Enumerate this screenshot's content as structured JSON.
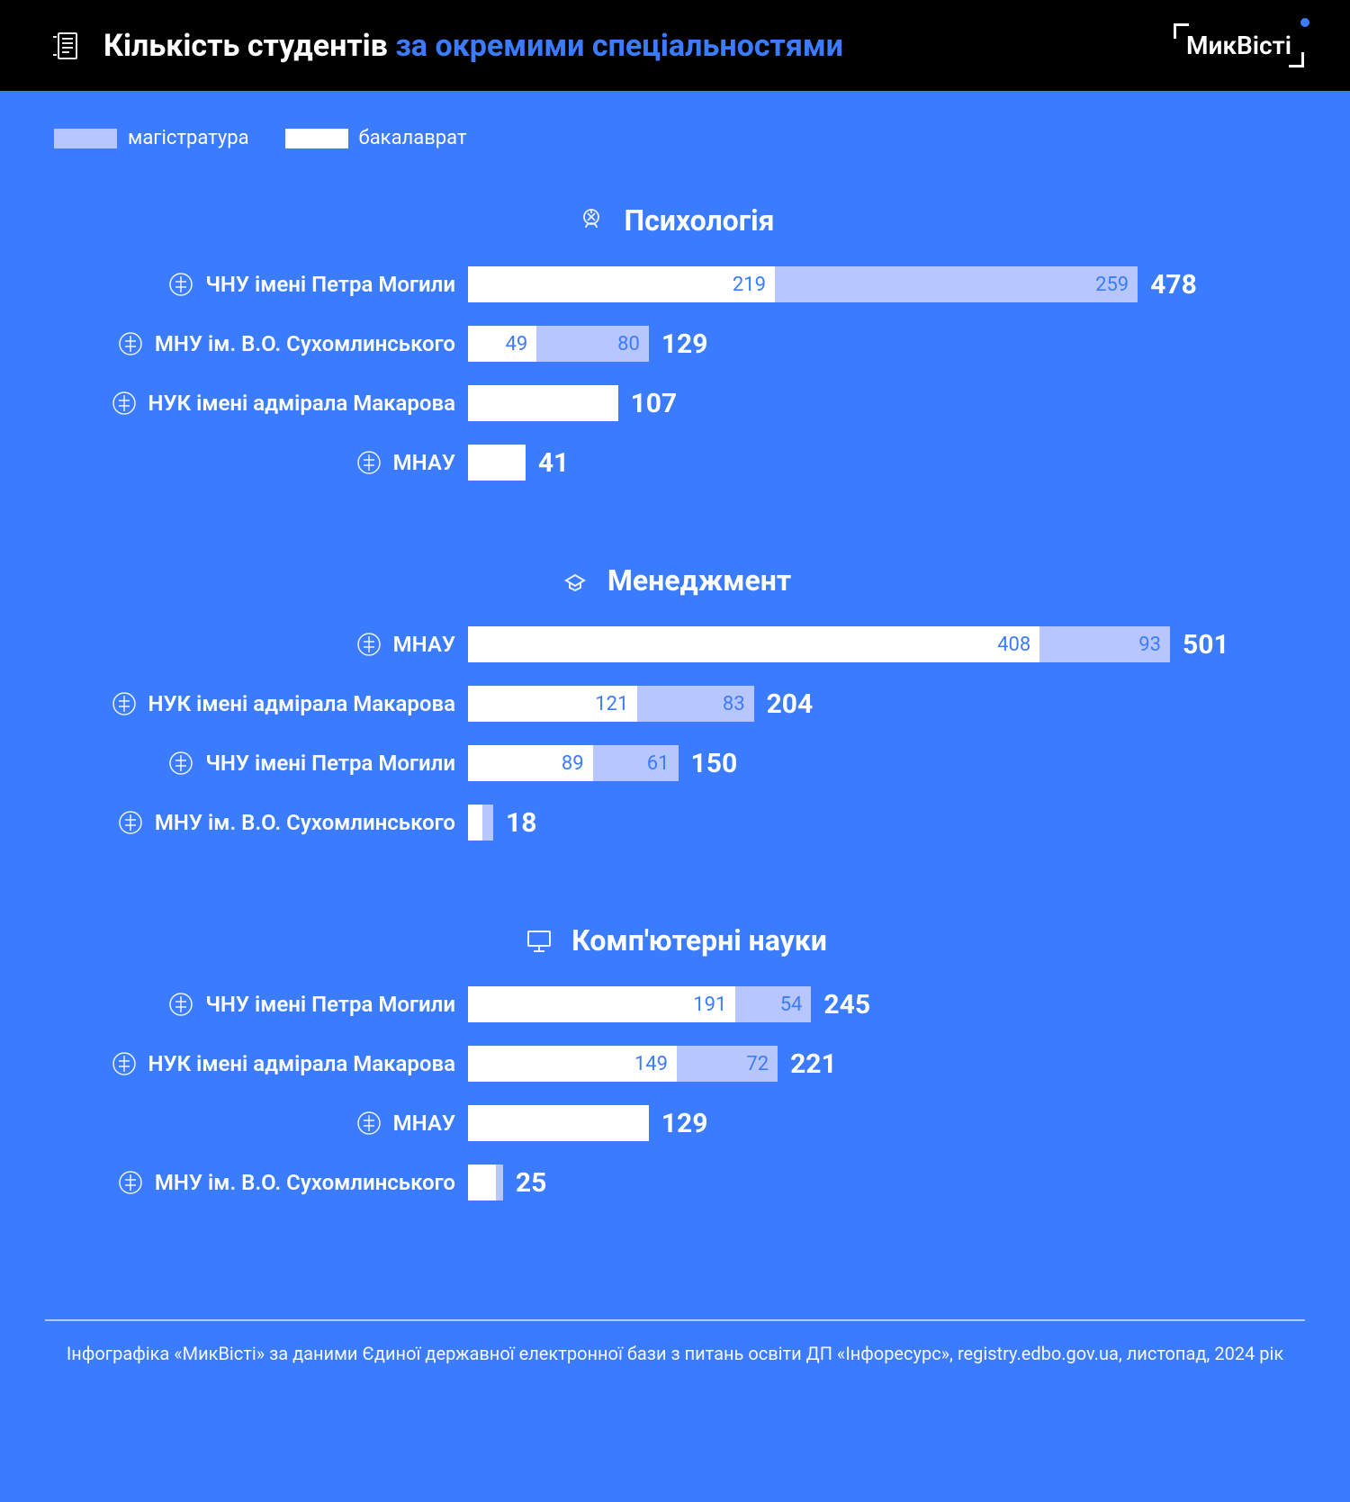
{
  "header": {
    "title_main": "Кількість студентів ",
    "title_accent": "за окремими спеціальностями",
    "brand": "МикВісті"
  },
  "legend": {
    "masters": "магістратура",
    "bachelors": "бакалаврат"
  },
  "footer": "Інфографіка «МикВісті» за даними Єдиної державної електронної бази з питань освіти ДП «Інфоресурс», registry.edbo.gov.ua, листопад, 2024 рік",
  "chart_data": [
    {
      "type": "bar",
      "title": "Психологія",
      "legend": [
        "бакалаврат",
        "магістратура"
      ],
      "max": 501,
      "rows": [
        {
          "label": "ЧНУ імені Петра Могили",
          "bachelors": 219,
          "masters": 259,
          "total": 478
        },
        {
          "label": "МНУ ім. В.О. Сухомлинського",
          "bachelors": 49,
          "masters": 80,
          "total": 129
        },
        {
          "label": "НУК імені адмірала Макарова",
          "bachelors": 107,
          "masters": null,
          "total": 107
        },
        {
          "label": "МНАУ",
          "bachelors": 41,
          "masters": null,
          "total": 41
        }
      ]
    },
    {
      "type": "bar",
      "title": "Менеджмент",
      "legend": [
        "бакалаврат",
        "магістратура"
      ],
      "max": 501,
      "rows": [
        {
          "label": "МНАУ",
          "bachelors": 408,
          "masters": 93,
          "total": 501
        },
        {
          "label": "НУК імені адмірала Макарова",
          "bachelors": 121,
          "masters": 83,
          "total": 204
        },
        {
          "label": "ЧНУ імені Петра Могили",
          "bachelors": 89,
          "masters": 61,
          "total": 150
        },
        {
          "label": "МНУ ім. В.О. Сухомлинського",
          "bachelors": 10,
          "masters": 8,
          "total": 18
        }
      ]
    },
    {
      "type": "bar",
      "title": "Комп'ютерні науки",
      "legend": [
        "бакалаврат",
        "магістратура"
      ],
      "max": 501,
      "rows": [
        {
          "label": "ЧНУ імені Петра Могили",
          "bachelors": 191,
          "masters": 54,
          "total": 245
        },
        {
          "label": "НУК імені адмірала Макарова",
          "bachelors": 149,
          "masters": 72,
          "total": 221
        },
        {
          "label": "МНАУ",
          "bachelors": 129,
          "masters": null,
          "total": 129
        },
        {
          "label": "МНУ ім. В.О. Сухомлинського",
          "bachelors": 20,
          "masters": 5,
          "total": 25
        }
      ]
    }
  ]
}
